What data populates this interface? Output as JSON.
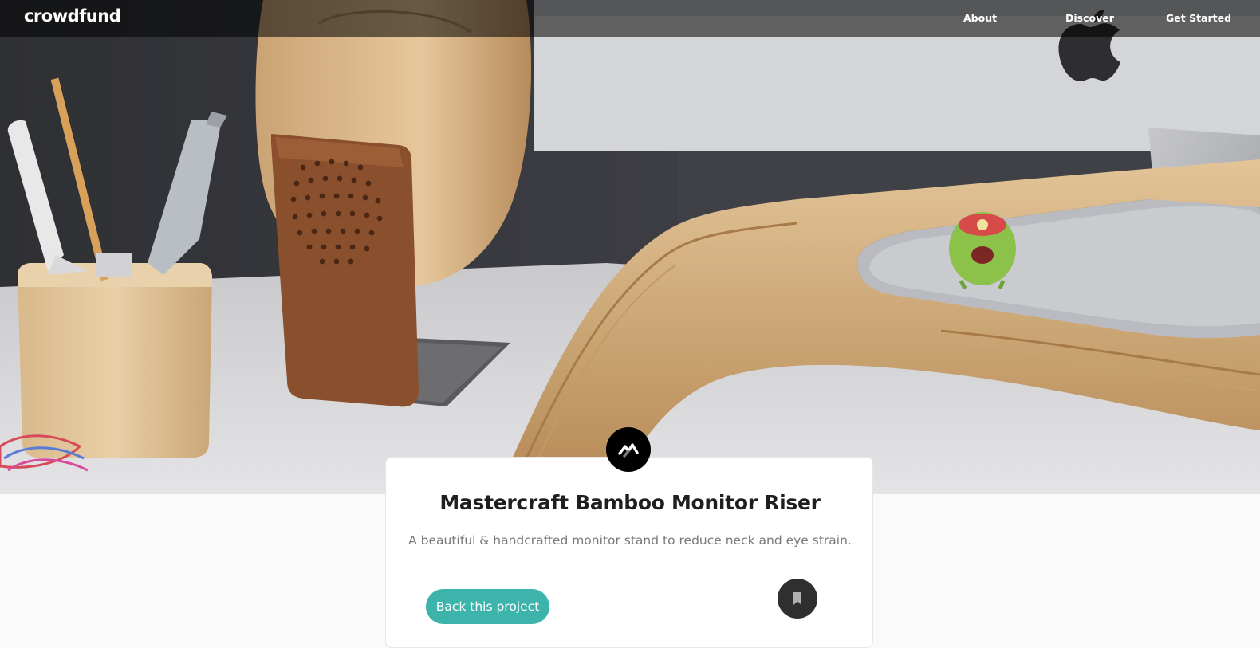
{
  "navbar": {
    "logo": "crowdfund",
    "links": [
      "About",
      "Discover",
      "Get Started"
    ]
  },
  "hero": {
    "image": "desk-with-bamboo-monitor-riser-photo"
  },
  "project": {
    "brand_icon": "mastercraft-logo-icon",
    "title": "Mastercraft Bamboo Monitor Riser",
    "description": "A beautiful & handcrafted monitor stand to reduce neck and eye strain.",
    "back_button_label": "Back this project",
    "bookmark_icon": "bookmark-icon"
  },
  "colors": {
    "accent": "#3cb4ac",
    "dark": "#2f2f2f",
    "navbar_overlay": "rgba(0,0,0,0.55)"
  }
}
